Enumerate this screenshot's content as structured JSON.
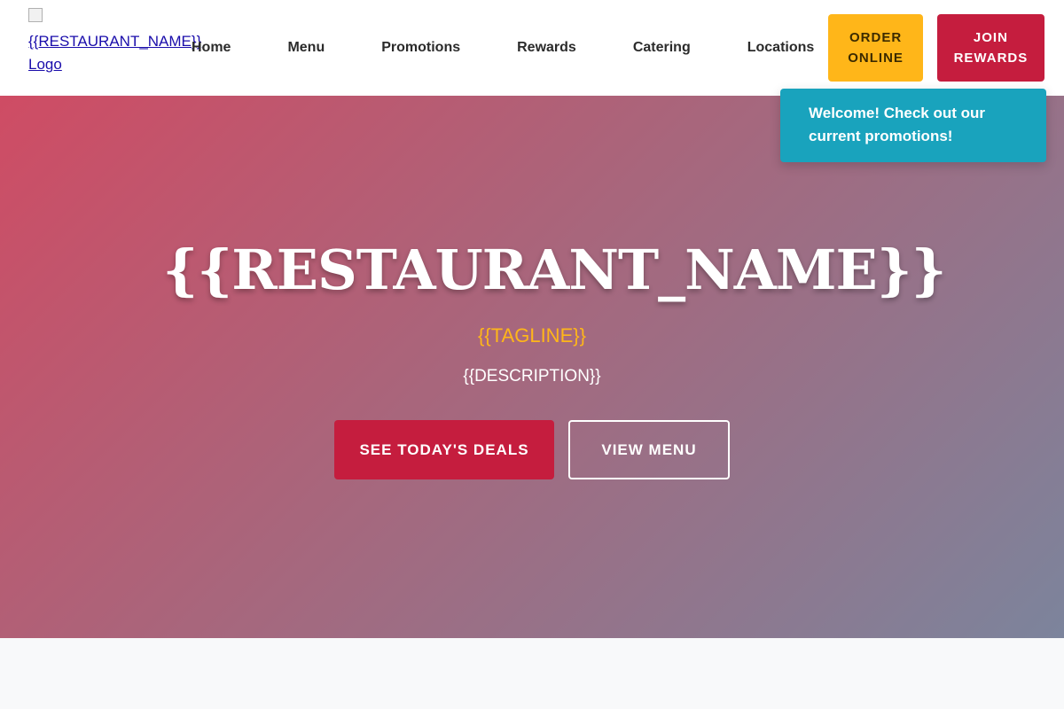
{
  "header": {
    "logo_alt": "{{RESTAURANT_NAME}} Logo",
    "nav": [
      {
        "label": "Home"
      },
      {
        "label": "Menu"
      },
      {
        "label": "Promotions"
      },
      {
        "label": "Rewards"
      },
      {
        "label": "Catering"
      },
      {
        "label": "Locations"
      }
    ],
    "order_button": "ORDER ONLINE",
    "join_button": "JOIN REWARDS"
  },
  "hero": {
    "title": "{{RESTAURANT_NAME}}",
    "tagline": "{{TAGLINE}}",
    "description": "{{DESCRIPTION}}",
    "primary_button": "SEE TODAY'S DEALS",
    "secondary_button": "VIEW MENU"
  },
  "toast": {
    "message": "Welcome! Check out our current promotions!"
  },
  "colors": {
    "accent_yellow": "#ffb619",
    "accent_red": "#c51d3e",
    "toast_teal": "#19a3bd"
  }
}
